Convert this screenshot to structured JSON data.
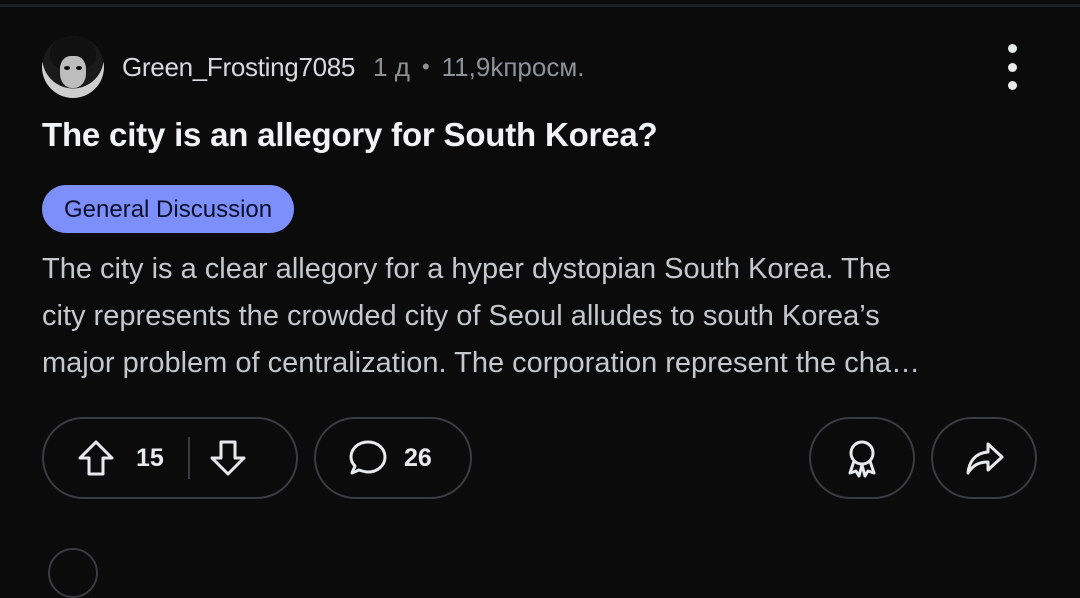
{
  "post": {
    "author": "Green_Frosting7085",
    "age": "1 д",
    "separator": "•",
    "views": "11,9kпросм.",
    "title": "The city is an allegory for South Korea?",
    "flair": "General Discussion",
    "flair_color": "#7c8ffa",
    "body_lines": [
      "The city is a clear allegory for a hyper dystopian South Korea. The",
      "city represents the crowded city of Seoul alludes to south Korea’s",
      "major problem of centralization. The corporation represent the cha…"
    ]
  },
  "actions": {
    "vote_score": "15",
    "comment_count": "26",
    "icons": [
      "upvote-icon",
      "downvote-icon",
      "comment-icon",
      "award-icon",
      "share-icon",
      "more-options-icon"
    ]
  }
}
